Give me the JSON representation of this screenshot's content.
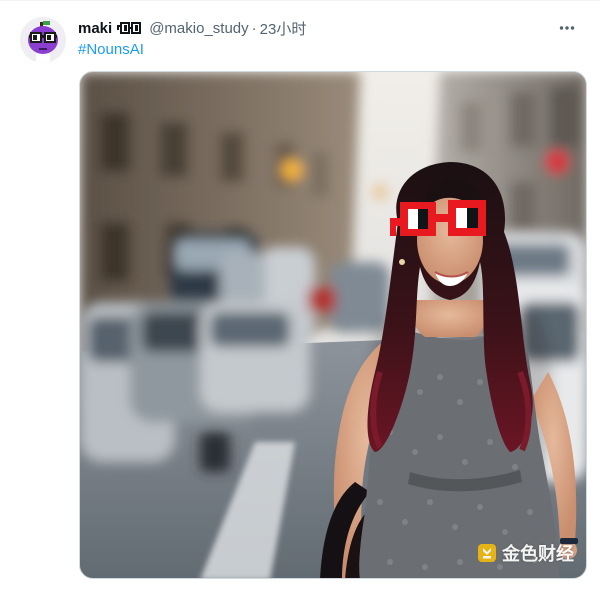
{
  "tweet": {
    "author": {
      "display_name": "maki",
      "name_glyph": "noggles-emoji",
      "handle": "@makio_study",
      "avatar": "purple-noun-avatar"
    },
    "separator": "·",
    "time": "23小时",
    "more_icon": "more-horizontal-icon",
    "hashtag": "#NounsAI"
  },
  "media": {
    "watermark_text": "金色财经",
    "watermark_icon": "jinse-logo-icon"
  },
  "colors": {
    "link": "#1d9bf0",
    "secondary_text": "#536471",
    "noggles_red": "#e8191f",
    "avatar_purple": "#8a3fd1"
  }
}
